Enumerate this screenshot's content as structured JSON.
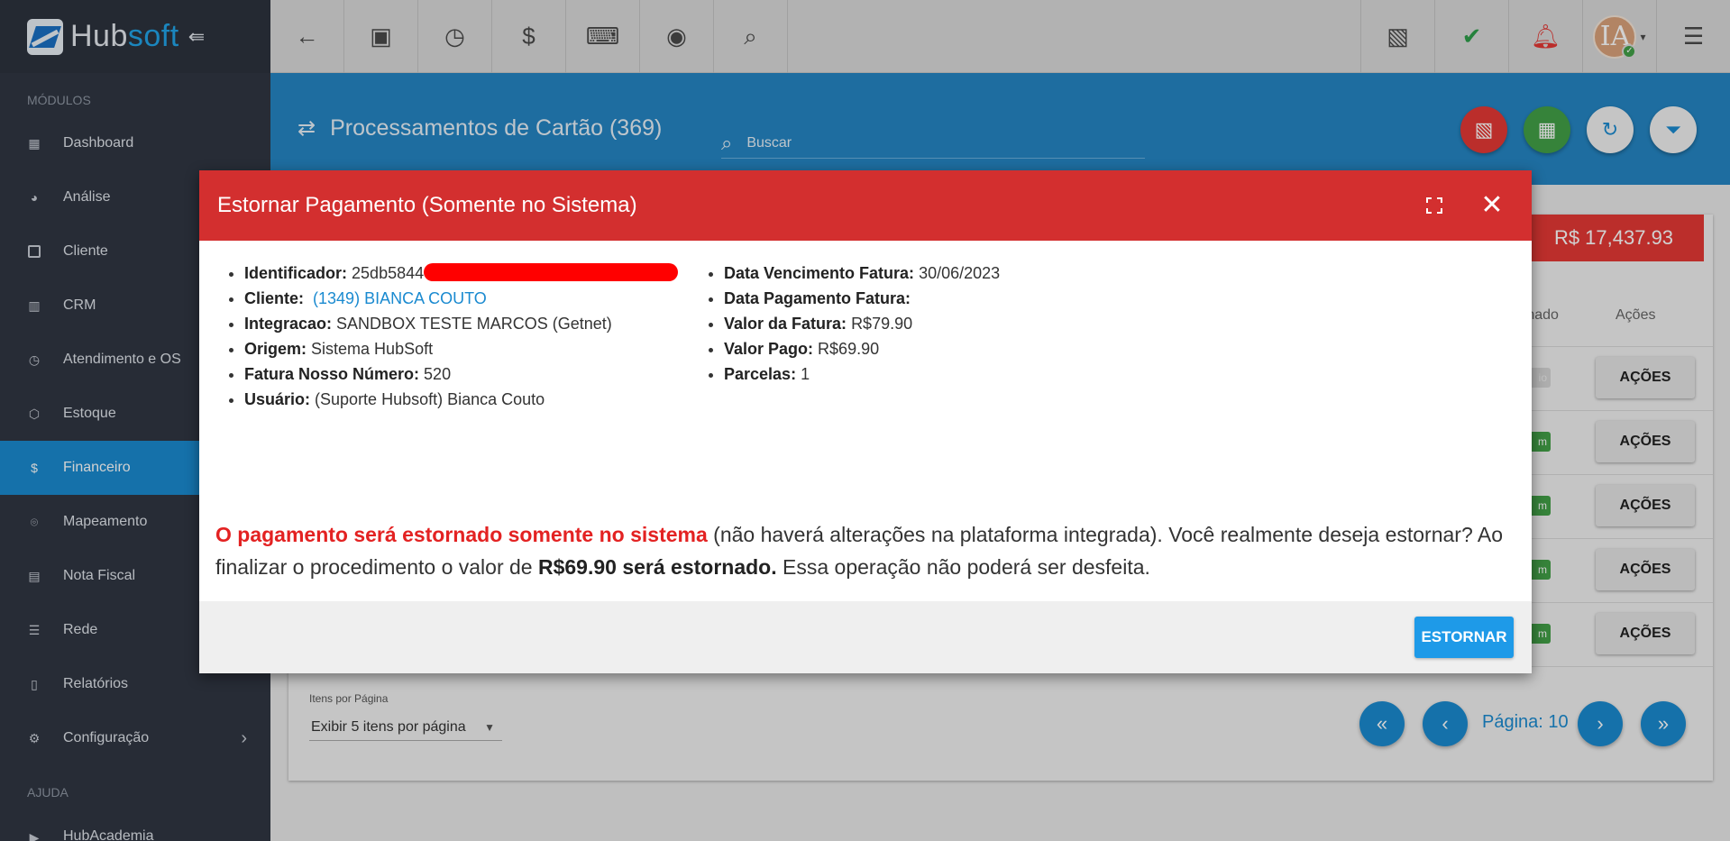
{
  "app": {
    "logo_hub": "Hub",
    "logo_soft": "soft"
  },
  "sidebar": {
    "section_modules": "MÓDULOS",
    "section_help": "AJUDA",
    "items": [
      {
        "label": "Dashboard",
        "icon": "dashboard-icon"
      },
      {
        "label": "Análise",
        "icon": "pie-chart-icon"
      },
      {
        "label": "Cliente",
        "icon": "contact-card-icon"
      },
      {
        "label": "CRM",
        "icon": "board-icon"
      },
      {
        "label": "Atendimento e OS",
        "icon": "calendar-clock-icon"
      },
      {
        "label": "Estoque",
        "icon": "box-icon"
      },
      {
        "label": "Financeiro",
        "icon": "money-icon",
        "active": true
      },
      {
        "label": "Mapeamento",
        "icon": "map-pin-icon"
      },
      {
        "label": "Nota Fiscal",
        "icon": "receipt-icon"
      },
      {
        "label": "Rede",
        "icon": "server-icon"
      },
      {
        "label": "Relatórios",
        "icon": "document-icon"
      },
      {
        "label": "Configuração",
        "icon": "gear-icon"
      }
    ],
    "help_items": [
      {
        "label": "HubAcademia",
        "icon": "video-icon"
      }
    ]
  },
  "page": {
    "title": "Processamentos de Cartão (369)",
    "search_placeholder": "Buscar",
    "total": "R$ 17,437.93",
    "col_estornado": "rnado",
    "col_acoes": "Ações",
    "chip_status": "m",
    "chip_gray": "io",
    "acoes_label": "AÇÕES",
    "per_page_label": "Itens por Página",
    "per_page_value": "Exibir 5 itens por página",
    "pagination_label": "Página: 10"
  },
  "colors": {
    "accent": "#1a8ad0",
    "danger": "#d32f2f",
    "sidebar": "#303642"
  },
  "modal": {
    "title": "Estornar Pagamento (Somente no Sistema)",
    "left": {
      "identificador_label": "Identificador:",
      "identificador_value": "25db5844",
      "cliente_label": "Cliente:",
      "cliente_value": "(1349) BIANCA COUTO",
      "integracao_label": "Integracao:",
      "integracao_value": "SANDBOX TESTE MARCOS (Getnet)",
      "origem_label": "Origem:",
      "origem_value": "Sistema HubSoft",
      "fatura_label": "Fatura Nosso Número:",
      "fatura_value": "520",
      "usuario_label": "Usuário:",
      "usuario_value": "(Suporte Hubsoft) Bianca Couto"
    },
    "right": {
      "vencimento_label": "Data Vencimento Fatura:",
      "vencimento_value": "30/06/2023",
      "pagamento_label": "Data Pagamento Fatura:",
      "valor_fatura_label": "Valor da Fatura:",
      "valor_fatura_value": "R$79.90",
      "valor_pago_label": "Valor Pago:",
      "valor_pago_value": "R$69.90",
      "parcelas_label": "Parcelas:",
      "parcelas_value": "1"
    },
    "warning": {
      "red": "O pagamento será estornado somente no sistema",
      "part1": " (não haverá alterações na plataforma integrada). Você realmente deseja estornar? Ao finalizar o procedimento o valor de ",
      "bold": "R$69.90 será estornado.",
      "part2": " Essa operação não poderá ser desfeita."
    },
    "confirm_button": "ESTORNAR"
  }
}
